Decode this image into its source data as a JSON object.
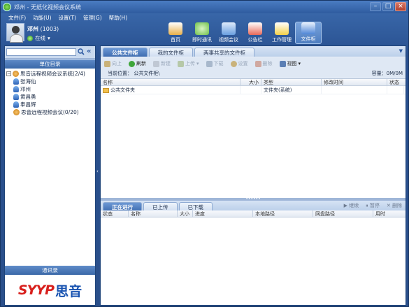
{
  "window": {
    "title": "邓州 - 无纸化视频会议系统"
  },
  "menu": [
    "文件(F)",
    "功能(U)",
    "设置(T)",
    "管理(G)",
    "帮助(H)"
  ],
  "user": {
    "name": "邓州",
    "id": "(1003)",
    "status": "在线"
  },
  "nav": [
    {
      "label": "首页",
      "icon": "home-icon",
      "color": "#e8b04a"
    },
    {
      "label": "即时通讯",
      "icon": "chat-icon",
      "color": "#6fc04a"
    },
    {
      "label": "视频会议",
      "icon": "video-conference-icon",
      "color": "#6aa0e0"
    },
    {
      "label": "公告栏",
      "icon": "bulletin-icon",
      "color": "#e86a5a"
    },
    {
      "label": "工作管理",
      "icon": "work-icon",
      "color": "#f2d04a"
    },
    {
      "label": "文件柜",
      "icon": "file-cabinet-icon",
      "color": "#4f86d6"
    }
  ],
  "left": {
    "unit_dir": "单位目录",
    "contacts": "通讯录",
    "tree": [
      {
        "label": "思音远程视频会议系统(2/4)",
        "type": "org"
      },
      {
        "label": "张海仙",
        "type": "person"
      },
      {
        "label": "邓州",
        "type": "person"
      },
      {
        "label": "黄昌勇",
        "type": "person"
      },
      {
        "label": "奉昌辉",
        "type": "person"
      },
      {
        "label": "思音远程视频会议(0/20)",
        "type": "org"
      }
    ],
    "brand": {
      "latin": "SYYP",
      "cjk": "思音"
    }
  },
  "files": {
    "tabs": [
      "公共文件柜",
      "我的文件柜",
      "两事共享的文件柜"
    ],
    "toolbar": [
      {
        "label": "向上",
        "enabled": false
      },
      {
        "label": "刷新",
        "enabled": true
      },
      {
        "label": "新建",
        "enabled": false
      },
      {
        "label": "上传",
        "enabled": false
      },
      {
        "label": "下载",
        "enabled": false
      },
      {
        "label": "设置",
        "enabled": false
      },
      {
        "label": "删除",
        "enabled": false
      },
      {
        "label": "视图",
        "enabled": true
      }
    ],
    "location_label": "当前位置：",
    "location": "公共文件柜\\",
    "capacity": "容量：0M/0M",
    "columns": [
      "名称",
      "大小",
      "类型",
      "修改时间",
      "状态"
    ],
    "rows": [
      {
        "name": "公共文件夹",
        "size": "",
        "type": "文件夹(系统)",
        "mtime": "",
        "status": ""
      }
    ]
  },
  "transfers": {
    "tabs": [
      "正在进行",
      "已上传",
      "已下载"
    ],
    "actions": [
      "继续",
      "暂停",
      "删除"
    ],
    "columns": [
      "状态",
      "名称",
      "大小",
      "进度",
      "本地路径",
      "网盘路径",
      "用时"
    ]
  }
}
